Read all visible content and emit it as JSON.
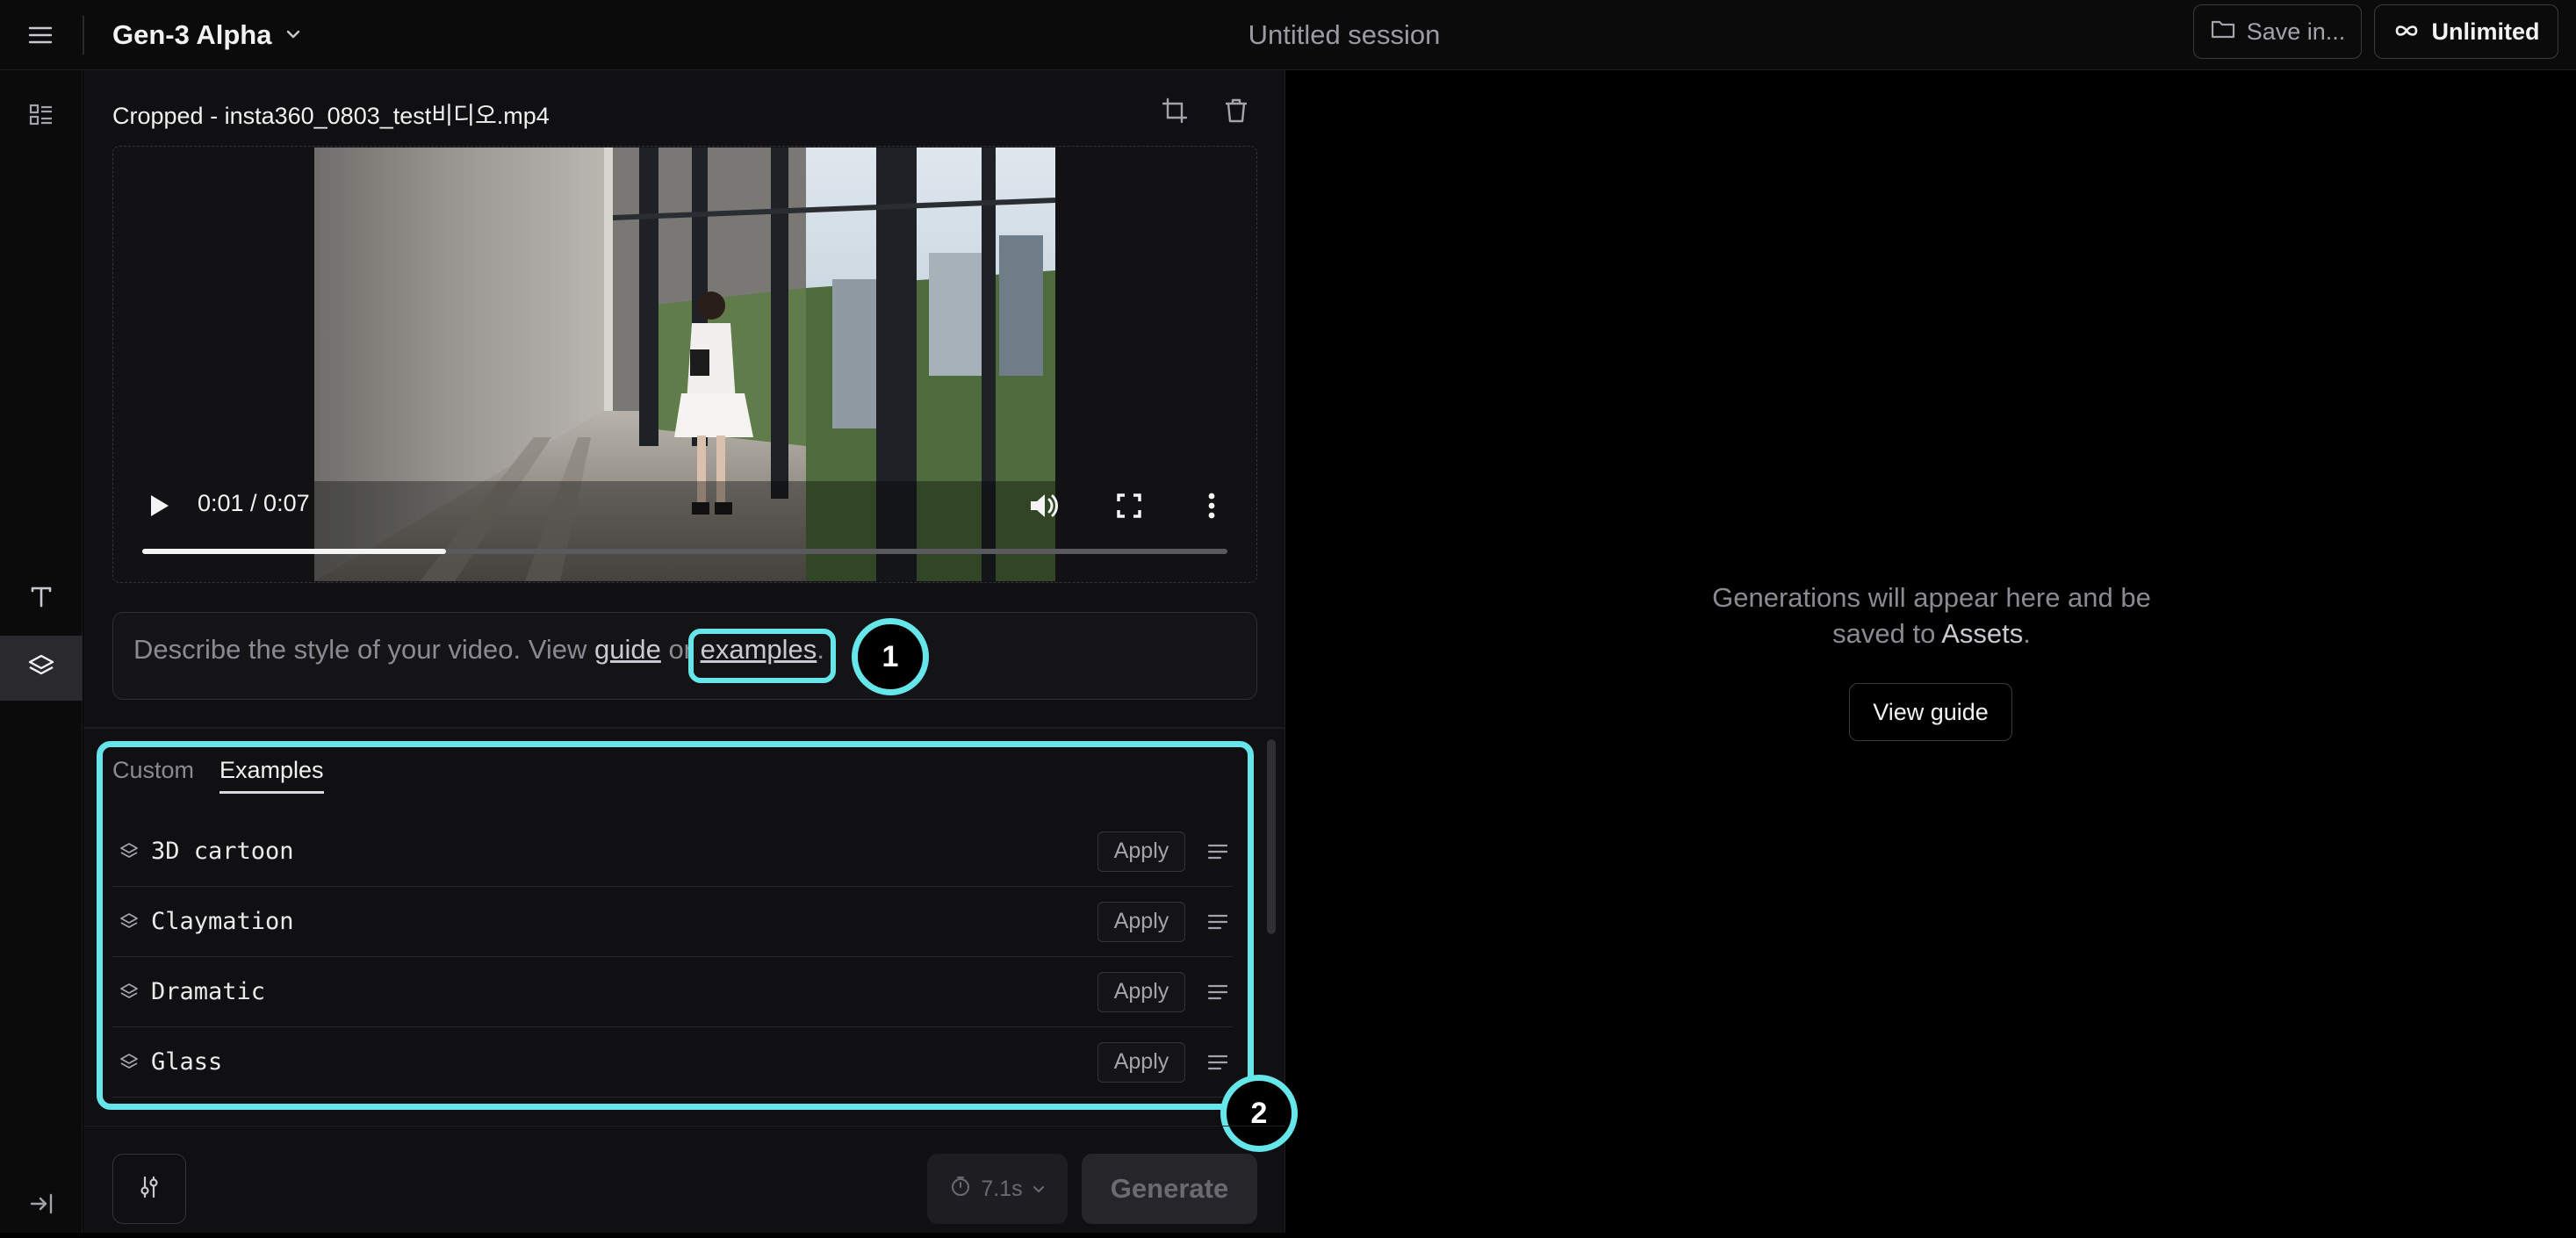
{
  "topbar": {
    "model_name": "Gen-3 Alpha",
    "session_title": "Untitled session",
    "save_label": "Save in...",
    "plan_label": "Unlimited"
  },
  "sidebar": {
    "items": [
      {
        "name": "dashboard",
        "icon": "dashboard-icon"
      },
      {
        "name": "text",
        "icon": "text-icon"
      },
      {
        "name": "styles",
        "icon": "layers-icon",
        "active": true
      },
      {
        "name": "collapse",
        "icon": "collapse-sidebar-icon"
      }
    ]
  },
  "video": {
    "file_title": "Cropped - insta360_0803_test비디오.mp4",
    "time": "0:01 / 0:07",
    "progress_fraction": 0.28
  },
  "prompt": {
    "placeholder_prefix": "Describe the style of your video. View ",
    "guide_link": "guide",
    "or_text": " or ",
    "examples_link": "examples",
    "suffix": "."
  },
  "callouts": [
    "1",
    "2"
  ],
  "styles_panel": {
    "tabs": [
      {
        "label": "Custom",
        "selected": false
      },
      {
        "label": "Examples",
        "selected": true
      }
    ],
    "items": [
      {
        "name": "3D cartoon",
        "apply_label": "Apply"
      },
      {
        "name": "Claymation",
        "apply_label": "Apply"
      },
      {
        "name": "Dramatic",
        "apply_label": "Apply"
      },
      {
        "name": "Glass",
        "apply_label": "Apply"
      }
    ]
  },
  "bottom_bar": {
    "duration_label": "7.1s",
    "generate_label": "Generate"
  },
  "right_panel": {
    "message_line1": "Generations will appear here and be",
    "message_line2_prefix": "saved to ",
    "message_assets": "Assets",
    "message_suffix": ".",
    "view_guide_label": "View guide"
  },
  "colors": {
    "accent_highlight": "#66e6ea",
    "background": "#000000",
    "panel": "#101012"
  }
}
